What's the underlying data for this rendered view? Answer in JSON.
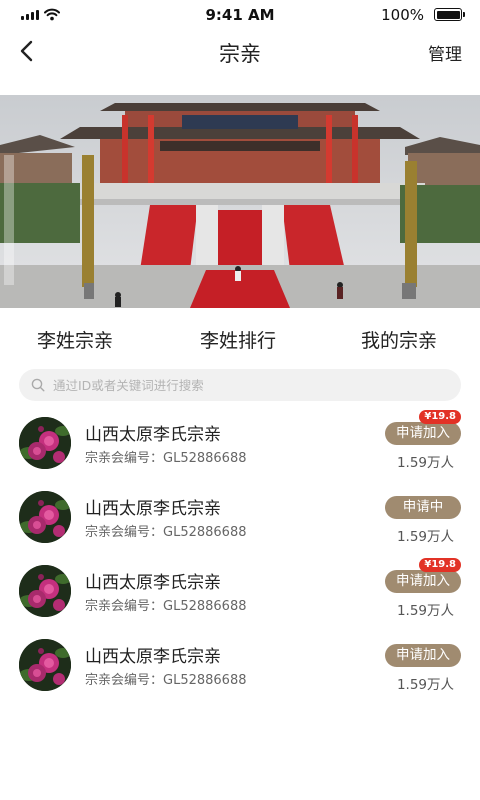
{
  "status_bar": {
    "time": "9:41 AM",
    "battery": "100%"
  },
  "header": {
    "title": "宗亲",
    "manage_label": "管理"
  },
  "tabs": [
    {
      "label": "李姓宗亲"
    },
    {
      "label": "李姓排行"
    },
    {
      "label": "我的宗亲"
    }
  ],
  "search": {
    "placeholder": "通过ID或者关键词进行搜索",
    "value": ""
  },
  "clans": [
    {
      "name": "山西太原李氏宗亲",
      "code_label": "宗亲会编号：",
      "code": "GL52886688",
      "button": "申请加入",
      "price": "¥19.8",
      "members": "1.59万人"
    },
    {
      "name": "山西太原李氏宗亲",
      "code_label": "宗亲会编号：",
      "code": "GL52886688",
      "button": "申请中",
      "price": "",
      "members": "1.59万人"
    },
    {
      "name": "山西太原李氏宗亲",
      "code_label": "宗亲会编号：",
      "code": "GL52886688",
      "button": "申请加入",
      "price": "¥19.8",
      "members": "1.59万人"
    },
    {
      "name": "山西太原李氏宗亲",
      "code_label": "宗亲会编号：",
      "code": "GL52886688",
      "button": "申请加入",
      "price": "",
      "members": "1.59万人"
    }
  ],
  "colors": {
    "accent_button": "#a08b70",
    "price_badge": "#e23226"
  },
  "icons": [
    "signal-icon",
    "wifi-icon",
    "battery-icon",
    "back-arrow-icon",
    "search-icon",
    "flower-avatar-icon"
  ]
}
